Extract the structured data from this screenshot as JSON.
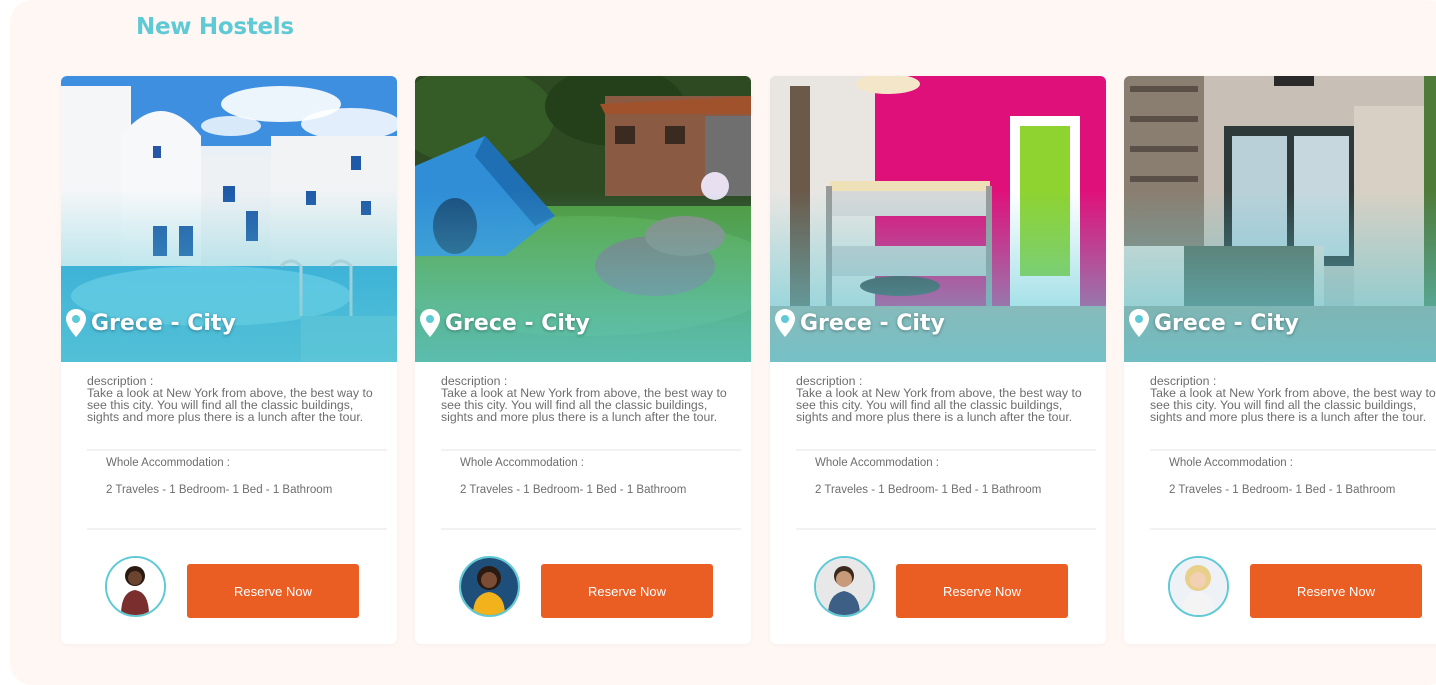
{
  "section": {
    "title": "New Hostels"
  },
  "colors": {
    "accent": "#5fc9d6",
    "button": "#ea5e24",
    "panel_bg": "#fff7f3"
  },
  "cards": [
    {
      "location": "Grece - City",
      "location_icon": "map-pin-icon",
      "image": "white-hotel-with-pool",
      "description_label": "description :",
      "description": "Take a look at New York from above, the best way to see this city. You will find all the classic buildings, sights and more plus there is a lunch after the tour.",
      "accommodation_label": "Whole Accommodation :",
      "accommodation_value": "2 Traveles - 1 Bedroom- 1 Bed - 1 Bathroom",
      "host_avatar": "man-in-red-shirt",
      "button_label": "Reserve Now"
    },
    {
      "location": "Grece - City",
      "location_icon": "map-pin-icon",
      "image": "tent-in-garden",
      "description_label": "description :",
      "description": "Take a look at New York from above, the best way to see this city. You will find all the classic buildings, sights and more plus there is a lunch after the tour.",
      "accommodation_label": "Whole Accommodation :",
      "accommodation_value": "2 Traveles - 1 Bedroom- 1 Bed - 1 Bathroom",
      "host_avatar": "woman-in-yellow",
      "button_label": "Reserve Now"
    },
    {
      "location": "Grece - City",
      "location_icon": "map-pin-icon",
      "image": "bunk-bed-room-pink-wall",
      "description_label": "description :",
      "description": "Take a look at New York from above, the best way to see this city. You will find all the classic buildings, sights and more plus there is a lunch after the tour.",
      "accommodation_label": "Whole Accommodation :",
      "accommodation_value": "2 Traveles - 1 Bedroom- 1 Bed - 1 Bathroom",
      "host_avatar": "man-in-denim",
      "button_label": "Reserve Now"
    },
    {
      "location": "Grece - City",
      "location_icon": "map-pin-icon",
      "image": "bedroom-with-balcony",
      "description_label": "description :",
      "description": "Take a look at New York from above, the best way to see this city. You will find all the classic buildings, sights and more plus there is a lunch after the tour.",
      "accommodation_label": "Whole Accommodation :",
      "accommodation_value": "2 Traveles - 1 Bedroom- 1 Bed - 1 Bathroom",
      "host_avatar": "blonde-woman",
      "button_label": "Reserve Now"
    }
  ]
}
